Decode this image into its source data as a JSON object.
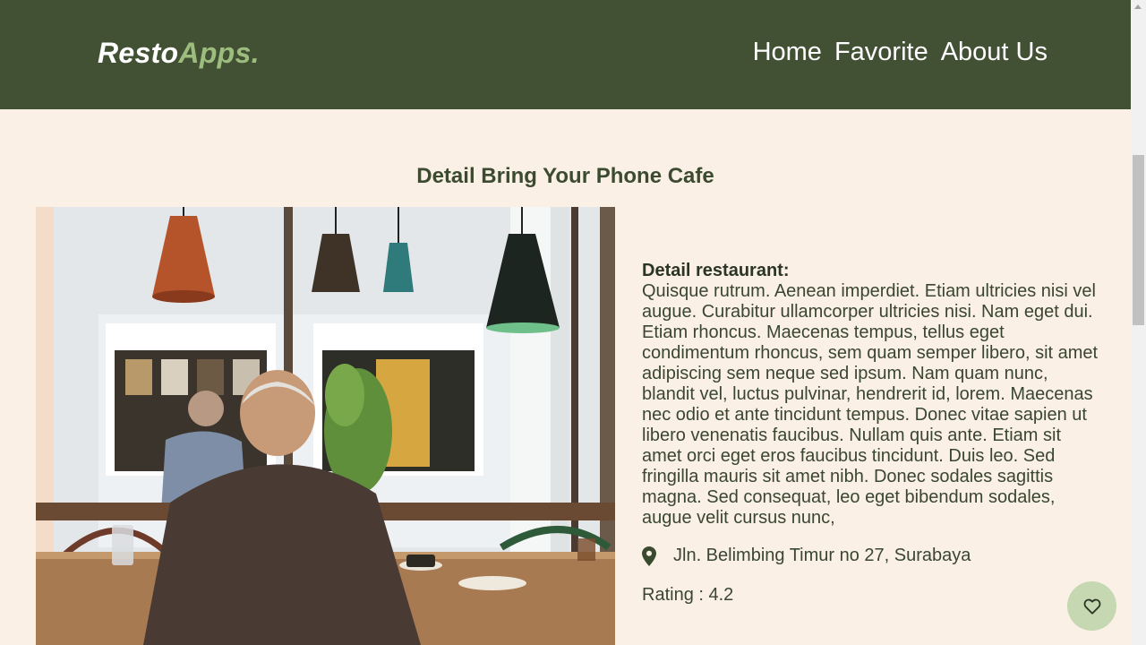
{
  "header": {
    "logo_main": "Resto",
    "logo_accent": "Apps.",
    "nav": [
      {
        "label": "Home"
      },
      {
        "label": "Favorite"
      },
      {
        "label": "About Us"
      }
    ]
  },
  "main": {
    "title": "Detail Bring Your Phone Cafe",
    "detail_label": "Detail restaurant:",
    "description": "Quisque rutrum. Aenean imperdiet. Etiam ultricies nisi vel augue. Curabitur ullamcorper ultricies nisi. Nam eget dui. Etiam rhoncus. Maecenas tempus, tellus eget condimentum rhoncus, sem quam semper libero, sit amet adipiscing sem neque sed ipsum. Nam quam nunc, blandit vel, luctus pulvinar, hendrerit id, lorem. Maecenas nec odio et ante tincidunt tempus. Donec vitae sapien ut libero venenatis faucibus. Nullam quis ante. Etiam sit amet orci eget eros faucibus tincidunt. Duis leo. Sed fringilla mauris sit amet nibh. Donec sodales sagittis magna. Sed consequat, leo eget bibendum sodales, augue velit cursus nunc,",
    "address": "Jln. Belimbing Timur no 27, Surabaya",
    "rating": "Rating : 4.2"
  },
  "icons": {
    "address": "map-marker-icon",
    "favorite": "heart-outline-icon"
  },
  "colors": {
    "header_bg": "#425034",
    "logo_accent": "#9dbd7e",
    "page_bg": "#faf0e6",
    "fav_button_bg": "#c5d8b1"
  }
}
